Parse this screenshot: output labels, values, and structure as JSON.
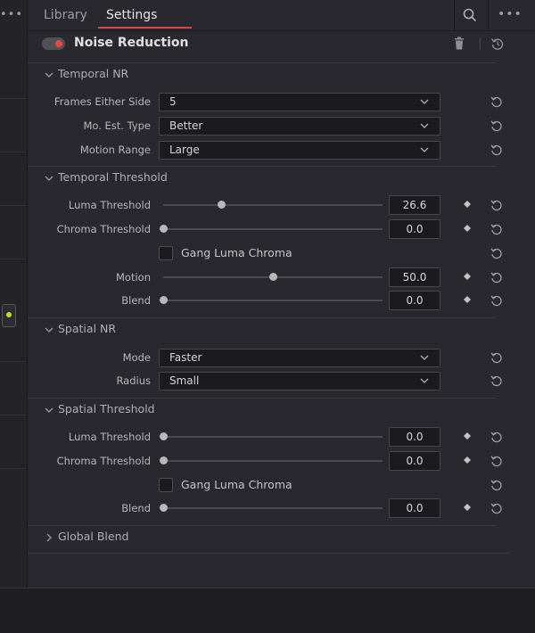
{
  "tabs": {
    "library": "Library",
    "settings": "Settings"
  },
  "header": {
    "title": "Noise Reduction",
    "enabled": true
  },
  "temporal_nr": {
    "label": "Temporal NR",
    "frames_either_side": {
      "label": "Frames Either Side",
      "value": "5"
    },
    "mo_est_type": {
      "label": "Mo. Est. Type",
      "value": "Better"
    },
    "motion_range": {
      "label": "Motion Range",
      "value": "Large"
    }
  },
  "temporal_threshold": {
    "label": "Temporal Threshold",
    "luma_threshold": {
      "label": "Luma Threshold",
      "value": "26.6",
      "fraction": 0.266
    },
    "chroma_threshold": {
      "label": "Chroma Threshold",
      "value": "0.0",
      "fraction": 0.0
    },
    "gang": {
      "label": "Gang Luma Chroma",
      "checked": false
    },
    "motion": {
      "label": "Motion",
      "value": "50.0",
      "fraction": 0.5
    },
    "blend": {
      "label": "Blend",
      "value": "0.0",
      "fraction": 0.0
    }
  },
  "spatial_nr": {
    "label": "Spatial NR",
    "mode": {
      "label": "Mode",
      "value": "Faster"
    },
    "radius": {
      "label": "Radius",
      "value": "Small"
    }
  },
  "spatial_threshold": {
    "label": "Spatial Threshold",
    "luma_threshold": {
      "label": "Luma Threshold",
      "value": "0.0",
      "fraction": 0.0
    },
    "chroma_threshold": {
      "label": "Chroma Threshold",
      "value": "0.0",
      "fraction": 0.0
    },
    "gang": {
      "label": "Gang Luma Chroma",
      "checked": false
    },
    "blend": {
      "label": "Blend",
      "value": "0.0",
      "fraction": 0.0
    }
  },
  "global_blend": {
    "label": "Global Blend"
  },
  "colors": {
    "accent": "#d9493e",
    "node_dot": "#b5e61d",
    "panel": "#28282e"
  }
}
